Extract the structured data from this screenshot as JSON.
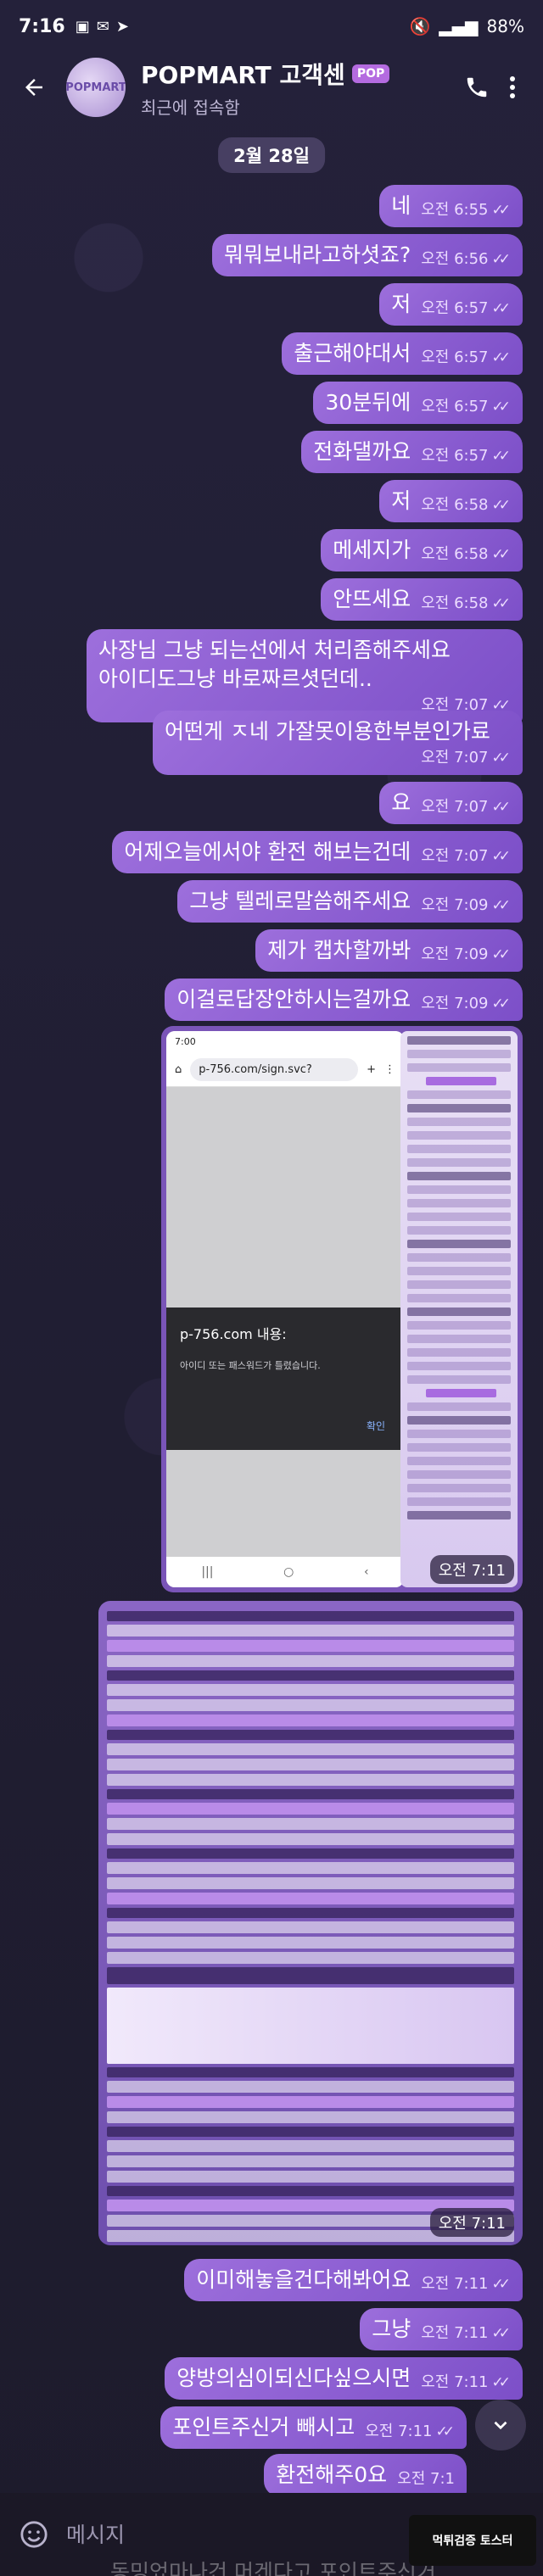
{
  "status_bar": {
    "time": "7:16",
    "battery": "88%"
  },
  "header": {
    "title": "POPMART 고객센",
    "badge": "POP",
    "subtitle": "최근에 접속함",
    "avatar_text": "POPMART"
  },
  "date_chip": "2월 28일",
  "messages": [
    {
      "text": "네",
      "time": "오전 6:55"
    },
    {
      "text": "뭐뭐보내라고하셧죠?",
      "time": "오전 6:56"
    },
    {
      "text": "저",
      "time": "오전 6:57"
    },
    {
      "text": "출근해야대서",
      "time": "오전 6:57"
    },
    {
      "text": "30분뒤에",
      "time": "오전 6:57"
    },
    {
      "text": "전화댈까요",
      "time": "오전 6:57"
    },
    {
      "text": "저",
      "time": "오전 6:58"
    },
    {
      "text": "메세지가",
      "time": "오전 6:58"
    },
    {
      "text": "안뜨세요",
      "time": "오전 6:58"
    },
    {
      "text": "사장님 그냥 되는선에서 처리좀해주세요\n아이디도그냥 바로짜르셧던데..",
      "time": "오전 7:07"
    },
    {
      "text": "어떤게 ㅈ네 가잘못이용한부분인가료",
      "time": "오전 7:07"
    },
    {
      "text": "요",
      "time": "오전 7:07"
    },
    {
      "text": "어제오늘에서야 환전 해보는건데",
      "time": "오전 7:07"
    },
    {
      "text": "그냥 텔레로말씀해주세요",
      "time": "오전 7:09"
    },
    {
      "text": "제가 캡차할까봐",
      "time": "오전 7:09"
    },
    {
      "text": "이걸로답장안하시는걸까요",
      "time": "오전 7:09"
    },
    {
      "text": "이미해놓을건다해봐어요",
      "time": "오전 7:11"
    },
    {
      "text": "그냥",
      "time": "오전 7:11"
    },
    {
      "text": "양방의심이되신다싶으시면",
      "time": "오전 7:11"
    },
    {
      "text": "포인트주신거 빼시고",
      "time": "오전 7:11"
    },
    {
      "text": "환전해주0요",
      "time": "오전 7:1"
    }
  ],
  "media1": {
    "time": "오전 7:11",
    "phone_time": "7:00",
    "url": "p-756.com/sign.svc?",
    "dialog_title": "p-756.com 내용:",
    "dialog_body": "아이디 또는 패스워드가 틀렸습니다.",
    "dialog_ok": "확인"
  },
  "media2": {
    "time": "오전 7:11"
  },
  "composer": {
    "placeholder": "메시지"
  },
  "partial_text": "동밍었마나건 머겐다고 포인트주신거",
  "watermark": "먹튀검증 토스터",
  "colors": {
    "bubble": "#8a5fd2",
    "background": "#1f1c2e"
  }
}
